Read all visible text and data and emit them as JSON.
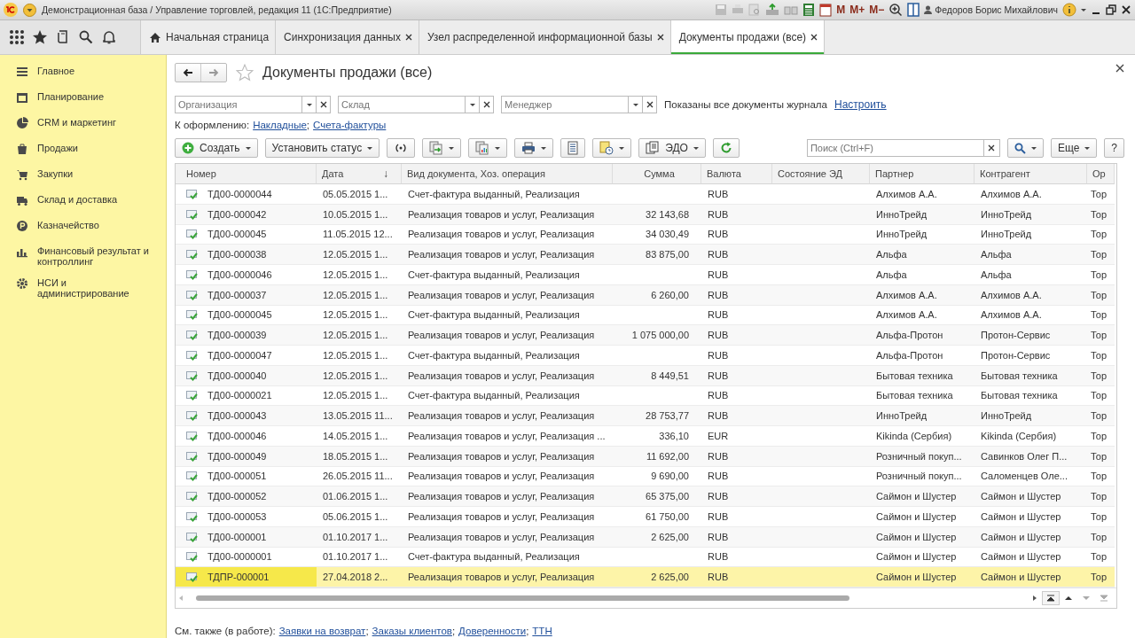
{
  "window": {
    "title": "Демонстрационная база / Управление торговлей, редакция 11  (1С:Предприятие)",
    "memory_buttons": [
      "M",
      "M+",
      "M−"
    ],
    "user": "Федоров Борис Михайлович"
  },
  "nav_tabs": [
    {
      "label": "Начальная страница",
      "kind": "home",
      "selected": false
    },
    {
      "label": "Синхронизация данных",
      "kind": "closable",
      "selected": false
    },
    {
      "label": "Узел распределенной информационной базы",
      "kind": "closable",
      "selected": false
    },
    {
      "label": "Документы продажи (все)",
      "kind": "closable",
      "selected": true
    }
  ],
  "sidebar": {
    "items": [
      {
        "label": "Главное",
        "kind": "main"
      },
      {
        "label": "Планирование",
        "kind": "planning"
      },
      {
        "label": "CRM и маркетинг",
        "kind": "crm"
      },
      {
        "label": "Продажи",
        "kind": "sales"
      },
      {
        "label": "Закупки",
        "kind": "purchases"
      },
      {
        "label": "Склад и доставка",
        "kind": "warehouse"
      },
      {
        "label": "Казначейство",
        "kind": "treasury"
      },
      {
        "label": "Финансовый результат и контроллинг",
        "kind": "finance"
      },
      {
        "label": "НСИ и администрирование",
        "kind": "admin"
      }
    ]
  },
  "form": {
    "title": "Документы продажи (все)",
    "filters": [
      {
        "placeholder": "Организация"
      },
      {
        "placeholder": "Склад"
      },
      {
        "placeholder": "Менеджер"
      }
    ],
    "journal_note": "Показаны все документы журнала",
    "settings_link": "Настроить",
    "to_process": {
      "label": "К оформлению:",
      "links": [
        "Накладные",
        "Счета-фактуры"
      ],
      "separator": ";"
    },
    "commands": [
      {
        "kind": "create",
        "label": "Создать",
        "dropdown": true
      },
      {
        "kind": "text",
        "label": "Установить статус",
        "dropdown": true
      },
      {
        "kind": "signal",
        "dropdown": false
      },
      {
        "kind": "exchange",
        "dropdown": true
      },
      {
        "kind": "report",
        "dropdown": true
      },
      {
        "kind": "print",
        "dropdown": true
      },
      {
        "kind": "list",
        "dropdown": false
      },
      {
        "kind": "docs",
        "dropdown": true
      },
      {
        "kind": "edo",
        "label": "ЭДО",
        "dropdown": true
      },
      {
        "kind": "refresh",
        "dropdown": false
      }
    ],
    "search": {
      "placeholder": "Поиск (Ctrl+F)"
    },
    "more_button": "Еще",
    "help_button": "?",
    "see_also": {
      "label": "См. также (в работе):",
      "links": [
        "Заявки на возврат",
        "Заказы клиентов",
        "Доверенности",
        "ТТН"
      ],
      "separator": ";"
    }
  },
  "table": {
    "columns": [
      {
        "label": "Номер"
      },
      {
        "label": "Дата",
        "sort_arrow": "↓"
      },
      {
        "label": "Вид документа, Хоз. операция"
      },
      {
        "label": "Сумма"
      },
      {
        "label": "Валюта"
      },
      {
        "label": "Состояние ЭД"
      },
      {
        "label": "Партнер"
      },
      {
        "label": "Контрагент"
      },
      {
        "label": "Ор"
      }
    ],
    "rows": [
      {
        "number": "ТД00-0000044",
        "date": "05.05.2015 1...",
        "operation": "Счет-фактура выданный, Реализация",
        "amount": "",
        "currency": "RUB",
        "partner": "Алхимов А.А.",
        "counterparty": "Алхимов А.А.",
        "column_10": "Тор",
        "selected": false
      },
      {
        "number": "ТД00-000042",
        "date": "10.05.2015 1...",
        "operation": "Реализация товаров и услуг, Реализация",
        "amount": "32 143,68",
        "currency": "RUB",
        "partner": "ИнноТрейд",
        "counterparty": "ИнноТрейд",
        "column_10": "Тор",
        "selected": false
      },
      {
        "number": "ТД00-000045",
        "date": "11.05.2015 12...",
        "operation": "Реализация товаров и услуг, Реализация",
        "amount": "34 030,49",
        "currency": "RUB",
        "partner": "ИнноТрейд",
        "counterparty": "ИнноТрейд",
        "column_10": "Тор",
        "selected": false
      },
      {
        "number": "ТД00-000038",
        "date": "12.05.2015 1...",
        "operation": "Реализация товаров и услуг, Реализация",
        "amount": "83 875,00",
        "currency": "RUB",
        "partner": "Альфа",
        "counterparty": "Альфа",
        "column_10": "Тор",
        "selected": false
      },
      {
        "number": "ТД00-0000046",
        "date": "12.05.2015 1...",
        "operation": "Счет-фактура выданный, Реализация",
        "amount": "",
        "currency": "RUB",
        "partner": "Альфа",
        "counterparty": "Альфа",
        "column_10": "Тор",
        "selected": false
      },
      {
        "number": "ТД00-000037",
        "date": "12.05.2015 1...",
        "operation": "Реализация товаров и услуг, Реализация",
        "amount": "6 260,00",
        "currency": "RUB",
        "partner": "Алхимов А.А.",
        "counterparty": "Алхимов А.А.",
        "column_10": "Тор",
        "selected": false
      },
      {
        "number": "ТД00-0000045",
        "date": "12.05.2015 1...",
        "operation": "Счет-фактура выданный, Реализация",
        "amount": "",
        "currency": "RUB",
        "partner": "Алхимов А.А.",
        "counterparty": "Алхимов А.А.",
        "column_10": "Тор",
        "selected": false
      },
      {
        "number": "ТД00-000039",
        "date": "12.05.2015 1...",
        "operation": "Реализация товаров и услуг, Реализация",
        "amount": "1 075 000,00",
        "currency": "RUB",
        "partner": "Альфа-Протон",
        "counterparty": "Протон-Сервис",
        "column_10": "Тор",
        "selected": false
      },
      {
        "number": "ТД00-0000047",
        "date": "12.05.2015 1...",
        "operation": "Счет-фактура выданный, Реализация",
        "amount": "",
        "currency": "RUB",
        "partner": "Альфа-Протон",
        "counterparty": "Протон-Сервис",
        "column_10": "Тор",
        "selected": false
      },
      {
        "number": "ТД00-000040",
        "date": "12.05.2015 1...",
        "operation": "Реализация товаров и услуг, Реализация",
        "amount": "8 449,51",
        "currency": "RUB",
        "partner": "Бытовая техника",
        "counterparty": "Бытовая техника",
        "column_10": "Тор",
        "selected": false
      },
      {
        "number": "ТД00-0000021",
        "date": "12.05.2015 1...",
        "operation": "Счет-фактура выданный, Реализация",
        "amount": "",
        "currency": "RUB",
        "partner": "Бытовая техника",
        "counterparty": "Бытовая техника",
        "column_10": "Тор",
        "selected": false
      },
      {
        "number": "ТД00-000043",
        "date": "13.05.2015 11...",
        "operation": "Реализация товаров и услуг, Реализация",
        "amount": "28 753,77",
        "currency": "RUB",
        "partner": "ИнноТрейд",
        "counterparty": "ИнноТрейд",
        "column_10": "Тор",
        "selected": false
      },
      {
        "number": "ТД00-000046",
        "date": "14.05.2015 1...",
        "operation": "Реализация товаров и услуг, Реализация ...",
        "amount": "336,10",
        "currency": "EUR",
        "partner": "Kikinda (Сербия)",
        "counterparty": "Kikinda (Сербия)",
        "column_10": "Тор",
        "selected": false
      },
      {
        "number": "ТД00-000049",
        "date": "18.05.2015 1...",
        "operation": "Реализация товаров и услуг, Реализация",
        "amount": "11 692,00",
        "currency": "RUB",
        "partner": "Розничный покуп...",
        "counterparty": "Савинков Олег П...",
        "column_10": "Тор",
        "selected": false
      },
      {
        "number": "ТД00-000051",
        "date": "26.05.2015 11...",
        "operation": "Реализация товаров и услуг, Реализация",
        "amount": "9 690,00",
        "currency": "RUB",
        "partner": "Розничный покуп...",
        "counterparty": "Саломенцев Оле...",
        "column_10": "Тор",
        "selected": false
      },
      {
        "number": "ТД00-000052",
        "date": "01.06.2015 1...",
        "operation": "Реализация товаров и услуг, Реализация",
        "amount": "65 375,00",
        "currency": "RUB",
        "partner": "Саймон и Шустер",
        "counterparty": "Саймон и Шустер",
        "column_10": "Тор",
        "selected": false
      },
      {
        "number": "ТД00-000053",
        "date": "05.06.2015 1...",
        "operation": "Реализация товаров и услуг, Реализация",
        "amount": "61 750,00",
        "currency": "RUB",
        "partner": "Саймон и Шустер",
        "counterparty": "Саймон и Шустер",
        "column_10": "Тор",
        "selected": false
      },
      {
        "number": "ТД00-000001",
        "date": "01.10.2017 1...",
        "operation": "Реализация товаров и услуг, Реализация",
        "amount": "2 625,00",
        "currency": "RUB",
        "partner": "Саймон и Шустер",
        "counterparty": "Саймон и Шустер",
        "column_10": "Тор",
        "selected": false
      },
      {
        "number": "ТД00-0000001",
        "date": "01.10.2017 1...",
        "operation": "Счет-фактура выданный, Реализация",
        "amount": "",
        "currency": "RUB",
        "partner": "Саймон и Шустер",
        "counterparty": "Саймон и Шустер",
        "column_10": "Тор",
        "selected": false
      },
      {
        "number": "ТДПР-000001",
        "date": "27.04.2018 2...",
        "operation": "Реализация товаров и услуг, Реализация",
        "amount": "2 625,00",
        "currency": "RUB",
        "partner": "Саймон и Шустер",
        "counterparty": "Саймон и Шустер",
        "column_10": "Тор",
        "selected": true
      }
    ]
  }
}
